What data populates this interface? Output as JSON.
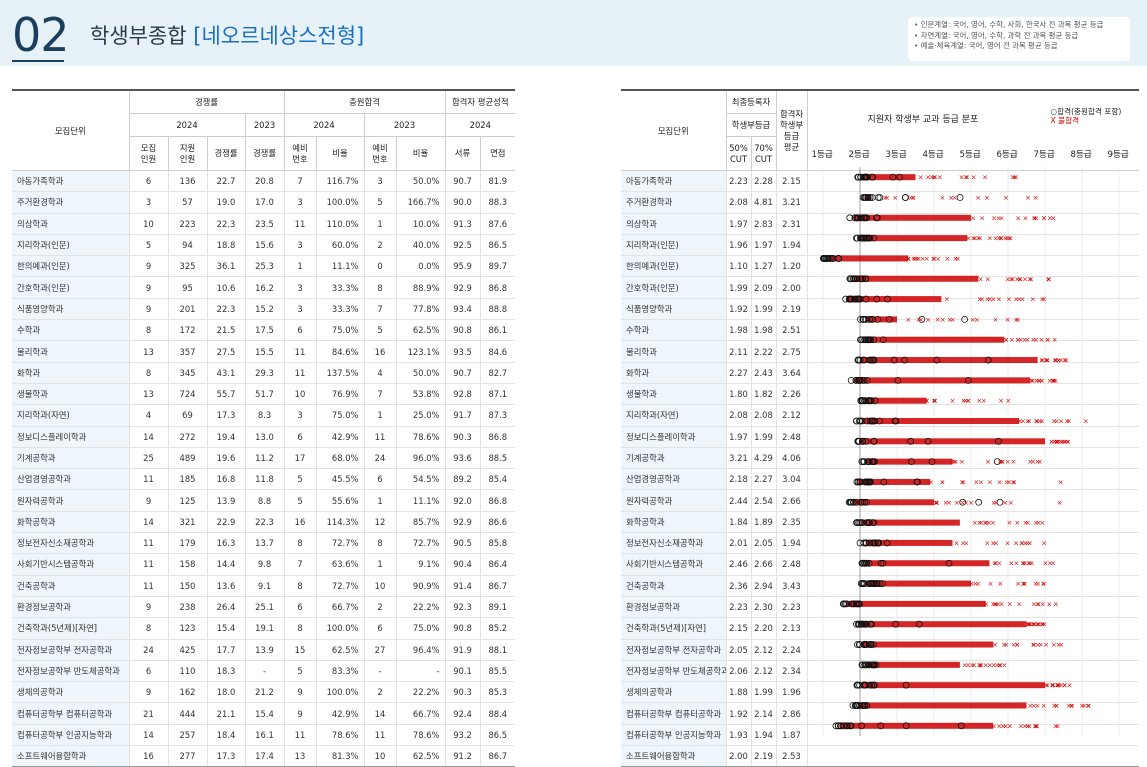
{
  "header": {
    "section_number": "02",
    "title": "학생부종합",
    "subtitle": "[네오르네상스전형]",
    "notes": [
      "• 인문계열: 국어, 영어, 수학, 사회, 한국사 전 과목 평균 등급",
      "• 자연계열: 국어, 영어, 수학, 과학 전 과목 평균 등급",
      "• 예술·체육계열: 국어, 영어 전 과목 평균 등급"
    ]
  },
  "left_table": {
    "h_unit": "모집단위",
    "h_competition": "경쟁률",
    "h_filled": "충원합격",
    "h_avg": "합격자 평균성적",
    "h_2024a": "2024",
    "h_2023a": "2023",
    "h_2024b": "2024",
    "h_2023b": "2023",
    "h_2024c": "2024",
    "h_recruit": "모집\n인원",
    "h_applicants": "지원\n인원",
    "h_rate": "경쟁률",
    "h_rate23": "경쟁률",
    "h_wait24": "예비\n번호",
    "h_ratio24": "비율",
    "h_wait23": "예비\n번호",
    "h_ratio23": "비율",
    "h_doc": "서류",
    "h_interview": "면접"
  },
  "right_table": {
    "h_unit": "모집단위",
    "h_final": "최종등록자",
    "h_final2": "학생부등급",
    "h_pass": "합격자\n학생부\n등급\n평균",
    "h_cut50": "50%\nCUT",
    "h_cut70": "70%\nCUT",
    "chart_title": "지원자 학생부 교과 등급 분포",
    "legend_pass": "○합격(충원합격 포함)",
    "legend_fail": "X 불합격",
    "grades": [
      "1등급",
      "2등급",
      "3등급",
      "4등급",
      "5등급",
      "6등급",
      "7등급",
      "8등급",
      "9등급"
    ]
  },
  "rows": [
    {
      "name": "아동가족학과",
      "recruit": "6",
      "applicants": "136",
      "rate": "22.7",
      "rate23": "20.8",
      "wait24": "7",
      "ratio24": "116.7%",
      "wait23": "3",
      "ratio23": "50.0%",
      "doc": "90.7",
      "interview": "81.9",
      "cut50": "2.23",
      "cut70": "2.28",
      "avg": "2.15"
    },
    {
      "name": "주거환경학과",
      "recruit": "3",
      "applicants": "57",
      "rate": "19.0",
      "rate23": "17.0",
      "wait24": "3",
      "ratio24": "100.0%",
      "wait23": "5",
      "ratio23": "166.7%",
      "doc": "90.0",
      "interview": "88.3",
      "cut50": "2.08",
      "cut70": "4.81",
      "avg": "3.21"
    },
    {
      "name": "의상학과",
      "recruit": "10",
      "applicants": "223",
      "rate": "22.3",
      "rate23": "23.5",
      "wait24": "11",
      "ratio24": "110.0%",
      "wait23": "1",
      "ratio23": "10.0%",
      "doc": "91.3",
      "interview": "87.6",
      "cut50": "1.97",
      "cut70": "2.83",
      "avg": "2.31"
    },
    {
      "name": "지리학과(인문)",
      "recruit": "5",
      "applicants": "94",
      "rate": "18.8",
      "rate23": "15.6",
      "wait24": "3",
      "ratio24": "60.0%",
      "wait23": "2",
      "ratio23": "40.0%",
      "doc": "92.5",
      "interview": "86.5",
      "cut50": "1.96",
      "cut70": "1.97",
      "avg": "1.94"
    },
    {
      "name": "한의예과(인문)",
      "recruit": "9",
      "applicants": "325",
      "rate": "36.1",
      "rate23": "25.3",
      "wait24": "1",
      "ratio24": "11.1%",
      "wait23": "0",
      "ratio23": "0.0%",
      "doc": "95.9",
      "interview": "89.7",
      "cut50": "1.10",
      "cut70": "1.27",
      "avg": "1.20"
    },
    {
      "name": "간호학과(인문)",
      "recruit": "9",
      "applicants": "95",
      "rate": "10.6",
      "rate23": "16.2",
      "wait24": "3",
      "ratio24": "33.3%",
      "wait23": "8",
      "ratio23": "88.9%",
      "doc": "92.9",
      "interview": "86.8",
      "cut50": "1.99",
      "cut70": "2.09",
      "avg": "2.00"
    },
    {
      "name": "식품영양학과",
      "recruit": "9",
      "applicants": "201",
      "rate": "22.3",
      "rate23": "15.2",
      "wait24": "3",
      "ratio24": "33.3%",
      "wait23": "7",
      "ratio23": "77.8%",
      "doc": "93.4",
      "interview": "88.8",
      "cut50": "1.92",
      "cut70": "1.99",
      "avg": "2.19"
    },
    {
      "name": "수학과",
      "recruit": "8",
      "applicants": "172",
      "rate": "21.5",
      "rate23": "17.5",
      "wait24": "6",
      "ratio24": "75.0%",
      "wait23": "5",
      "ratio23": "62.5%",
      "doc": "90.8",
      "interview": "86.1",
      "cut50": "1.98",
      "cut70": "1.98",
      "avg": "2.51"
    },
    {
      "name": "물리학과",
      "recruit": "13",
      "applicants": "357",
      "rate": "27.5",
      "rate23": "15.5",
      "wait24": "11",
      "ratio24": "84.6%",
      "wait23": "16",
      "ratio23": "123.1%",
      "doc": "93.5",
      "interview": "84.6",
      "cut50": "2.11",
      "cut70": "2.22",
      "avg": "2.75"
    },
    {
      "name": "화학과",
      "recruit": "8",
      "applicants": "345",
      "rate": "43.1",
      "rate23": "29.3",
      "wait24": "11",
      "ratio24": "137.5%",
      "wait23": "4",
      "ratio23": "50.0%",
      "doc": "90.7",
      "interview": "82.7",
      "cut50": "2.27",
      "cut70": "2.43",
      "avg": "3.64"
    },
    {
      "name": "생물학과",
      "recruit": "13",
      "applicants": "724",
      "rate": "55.7",
      "rate23": "51.7",
      "wait24": "10",
      "ratio24": "76.9%",
      "wait23": "7",
      "ratio23": "53.8%",
      "doc": "92.8",
      "interview": "87.1",
      "cut50": "1.80",
      "cut70": "1.82",
      "avg": "2.26"
    },
    {
      "name": "지리학과(자연)",
      "recruit": "4",
      "applicants": "69",
      "rate": "17.3",
      "rate23": "8.3",
      "wait24": "3",
      "ratio24": "75.0%",
      "wait23": "1",
      "ratio23": "25.0%",
      "doc": "91.7",
      "interview": "87.3",
      "cut50": "2.08",
      "cut70": "2.08",
      "avg": "2.12"
    },
    {
      "name": "정보디스플레이학과",
      "recruit": "14",
      "applicants": "272",
      "rate": "19.4",
      "rate23": "13.0",
      "wait24": "6",
      "ratio24": "42.9%",
      "wait23": "11",
      "ratio23": "78.6%",
      "doc": "90.3",
      "interview": "86.8",
      "cut50": "1.97",
      "cut70": "1.99",
      "avg": "2.48"
    },
    {
      "name": "기계공학과",
      "recruit": "25",
      "applicants": "489",
      "rate": "19.6",
      "rate23": "11.2",
      "wait24": "17",
      "ratio24": "68.0%",
      "wait23": "24",
      "ratio23": "96.0%",
      "doc": "93.6",
      "interview": "88.5",
      "cut50": "3.21",
      "cut70": "4.29",
      "avg": "4.06"
    },
    {
      "name": "산업경영공학과",
      "recruit": "11",
      "applicants": "185",
      "rate": "16.8",
      "rate23": "11.8",
      "wait24": "5",
      "ratio24": "45.5%",
      "wait23": "6",
      "ratio23": "54.5%",
      "doc": "89.2",
      "interview": "85.4",
      "cut50": "2.18",
      "cut70": "2.27",
      "avg": "3.04"
    },
    {
      "name": "원자력공학과",
      "recruit": "9",
      "applicants": "125",
      "rate": "13.9",
      "rate23": "8.8",
      "wait24": "5",
      "ratio24": "55.6%",
      "wait23": "1",
      "ratio23": "11.1%",
      "doc": "92.0",
      "interview": "86.8",
      "cut50": "2.44",
      "cut70": "2.54",
      "avg": "2.66"
    },
    {
      "name": "화학공학과",
      "recruit": "14",
      "applicants": "321",
      "rate": "22.9",
      "rate23": "22.3",
      "wait24": "16",
      "ratio24": "114.3%",
      "wait23": "12",
      "ratio23": "85.7%",
      "doc": "92.9",
      "interview": "86.6",
      "cut50": "1.84",
      "cut70": "1.89",
      "avg": "2.35"
    },
    {
      "name": "정보전자신소재공학과",
      "recruit": "11",
      "applicants": "179",
      "rate": "16.3",
      "rate23": "13.7",
      "wait24": "8",
      "ratio24": "72.7%",
      "wait23": "8",
      "ratio23": "72.7%",
      "doc": "90.5",
      "interview": "85.8",
      "cut50": "2.01",
      "cut70": "2.05",
      "avg": "1.94"
    },
    {
      "name": "사회기반시스템공학과",
      "recruit": "11",
      "applicants": "158",
      "rate": "14.4",
      "rate23": "9.8",
      "wait24": "7",
      "ratio24": "63.6%",
      "wait23": "1",
      "ratio23": "9.1%",
      "doc": "90.4",
      "interview": "86.4",
      "cut50": "2.46",
      "cut70": "2.66",
      "avg": "2.48"
    },
    {
      "name": "건축공학과",
      "recruit": "11",
      "applicants": "150",
      "rate": "13.6",
      "rate23": "9.1",
      "wait24": "8",
      "ratio24": "72.7%",
      "wait23": "10",
      "ratio23": "90.9%",
      "doc": "91.4",
      "interview": "86.7",
      "cut50": "2.36",
      "cut70": "2.94",
      "avg": "3.43"
    },
    {
      "name": "환경정보공학과",
      "recruit": "9",
      "applicants": "238",
      "rate": "26.4",
      "rate23": "25.1",
      "wait24": "6",
      "ratio24": "66.7%",
      "wait23": "2",
      "ratio23": "22.2%",
      "doc": "92.3",
      "interview": "89.1",
      "cut50": "2.23",
      "cut70": "2.30",
      "avg": "2.23"
    },
    {
      "name": "건축학과(5년제)[자연]",
      "recruit": "8",
      "applicants": "123",
      "rate": "15.4",
      "rate23": "19.1",
      "wait24": "8",
      "ratio24": "100.0%",
      "wait23": "6",
      "ratio23": "75.0%",
      "doc": "90.8",
      "interview": "85.2",
      "cut50": "2.15",
      "cut70": "2.20",
      "avg": "2.13"
    },
    {
      "name": "전자정보공학부 전자공학과",
      "recruit": "24",
      "applicants": "425",
      "rate": "17.7",
      "rate23": "13.9",
      "wait24": "15",
      "ratio24": "62.5%",
      "wait23": "27",
      "ratio23": "96.4%",
      "doc": "91.9",
      "interview": "88.1",
      "cut50": "2.05",
      "cut70": "2.12",
      "avg": "2.24"
    },
    {
      "name": "전자정보공학부 반도체공학과",
      "recruit": "6",
      "applicants": "110",
      "rate": "18.3",
      "rate23": "-",
      "wait24": "5",
      "ratio24": "83.3%",
      "wait23": "-",
      "ratio23": "-",
      "doc": "90.1",
      "interview": "85.5",
      "cut50": "2.06",
      "cut70": "2.12",
      "avg": "2.34"
    },
    {
      "name": "생체의공학과",
      "recruit": "9",
      "applicants": "162",
      "rate": "18.0",
      "rate23": "21.2",
      "wait24": "9",
      "ratio24": "100.0%",
      "wait23": "2",
      "ratio23": "22.2%",
      "doc": "90.3",
      "interview": "85.3",
      "cut50": "1.88",
      "cut70": "1.99",
      "avg": "1.96"
    },
    {
      "name": "컴퓨터공학부 컴퓨터공학과",
      "recruit": "21",
      "applicants": "444",
      "rate": "21.1",
      "rate23": "15.4",
      "wait24": "9",
      "ratio24": "42.9%",
      "wait23": "14",
      "ratio23": "66.7%",
      "doc": "92.4",
      "interview": "88.4",
      "cut50": "1.92",
      "cut70": "2.14",
      "avg": "2.86"
    },
    {
      "name": "컴퓨터공학부 인공지능학과",
      "recruit": "14",
      "applicants": "257",
      "rate": "18.4",
      "rate23": "16.1",
      "wait24": "11",
      "ratio24": "78.6%",
      "wait23": "11",
      "ratio23": "78.6%",
      "doc": "93.2",
      "interview": "86.5",
      "cut50": "1.93",
      "cut70": "1.94",
      "avg": "1.87"
    },
    {
      "name": "소프트웨어융합학과",
      "recruit": "16",
      "applicants": "277",
      "rate": "17.3",
      "rate23": "17.4",
      "wait24": "13",
      "ratio24": "81.3%",
      "wait23": "10",
      "ratio23": "62.5%",
      "doc": "91.2",
      "interview": "86.7",
      "cut50": "2.00",
      "cut70": "2.19",
      "avg": "2.53"
    }
  ],
  "chart_data": {
    "type": "scatter",
    "title": "지원자 학생부 교과 등급 분포",
    "x_categories": [
      "1등급",
      "2등급",
      "3등급",
      "4등급",
      "5등급",
      "6등급",
      "7등급",
      "8등급",
      "9등급"
    ],
    "xlim": [
      1,
      9.6
    ],
    "series": [
      {
        "name": "합격(충원합격 포함)",
        "marker": "circle",
        "color": "#000000"
      },
      {
        "name": "불합격",
        "marker": "x",
        "color": "#d40000"
      }
    ],
    "note": "applicant grade distribution per department (range of markers)",
    "rows": [
      {
        "min": 1.9,
        "pass_max": 3.4,
        "dense_max": 3.5,
        "max": 6.3
      },
      {
        "min": 2.0,
        "pass_max": 5.5,
        "dense_max": 2.3,
        "max": 7.1
      },
      {
        "min": 1.7,
        "pass_max": 3.4,
        "dense_max": 5.0,
        "max": 7.3
      },
      {
        "min": 1.9,
        "pass_max": 2.2,
        "dense_max": 4.9,
        "max": 6.2
      },
      {
        "min": 1.0,
        "pass_max": 1.4,
        "dense_max": 3.3,
        "max": 5.0
      },
      {
        "min": 1.7,
        "pass_max": 2.1,
        "dense_max": 5.2,
        "max": 7.3
      },
      {
        "min": 1.5,
        "pass_max": 3.0,
        "dense_max": 4.2,
        "max": 7.0
      },
      {
        "min": 2.0,
        "pass_max": 6.3,
        "dense_max": 3.0,
        "max": 6.6
      },
      {
        "min": 2.0,
        "pass_max": 2.7,
        "dense_max": 5.9,
        "max": 7.5
      },
      {
        "min": 1.9,
        "pass_max": 5.6,
        "dense_max": 6.8,
        "max": 7.6
      },
      {
        "min": 1.7,
        "pass_max": 5.2,
        "dense_max": 6.6,
        "max": 7.3
      },
      {
        "min": 2.0,
        "pass_max": 2.1,
        "dense_max": 3.8,
        "max": 6.1
      },
      {
        "min": 1.9,
        "pass_max": 3.6,
        "dense_max": 6.3,
        "max": 8.2
      },
      {
        "min": 1.9,
        "pass_max": 6.6,
        "dense_max": 7.0,
        "max": 7.7
      },
      {
        "min": 2.0,
        "pass_max": 6.9,
        "dense_max": 4.5,
        "max": 7.5
      },
      {
        "min": 1.8,
        "pass_max": 4.0,
        "dense_max": 3.9,
        "max": 7.5
      },
      {
        "min": 1.7,
        "pass_max": 6.4,
        "dense_max": 4.0,
        "max": 7.4
      },
      {
        "min": 1.9,
        "pass_max": 2.1,
        "dense_max": 4.7,
        "max": 7.0
      },
      {
        "min": 2.0,
        "pass_max": 2.9,
        "dense_max": 4.5,
        "max": 7.0
      },
      {
        "min": 2.0,
        "pass_max": 5.5,
        "dense_max": 5.5,
        "max": 7.3
      },
      {
        "min": 2.0,
        "pass_max": 2.8,
        "dense_max": 5.0,
        "max": 7.0
      },
      {
        "min": 1.5,
        "pass_max": 2.1,
        "dense_max": 5.4,
        "max": 7.5
      },
      {
        "min": 1.9,
        "pass_max": 3.7,
        "dense_max": 6.5,
        "max": 7.0
      },
      {
        "min": 1.9,
        "pass_max": 2.2,
        "dense_max": 5.6,
        "max": 7.5
      },
      {
        "min": 2.0,
        "pass_max": 2.3,
        "dense_max": 4.7,
        "max": 6.0
      },
      {
        "min": 1.9,
        "pass_max": 3.6,
        "dense_max": 7.0,
        "max": 7.7
      },
      {
        "min": 1.8,
        "pass_max": 2.2,
        "dense_max": 6.5,
        "max": 8.2
      },
      {
        "min": 1.3,
        "pass_max": 5.1,
        "dense_max": 5.6,
        "max": 7.4
      }
    ]
  }
}
